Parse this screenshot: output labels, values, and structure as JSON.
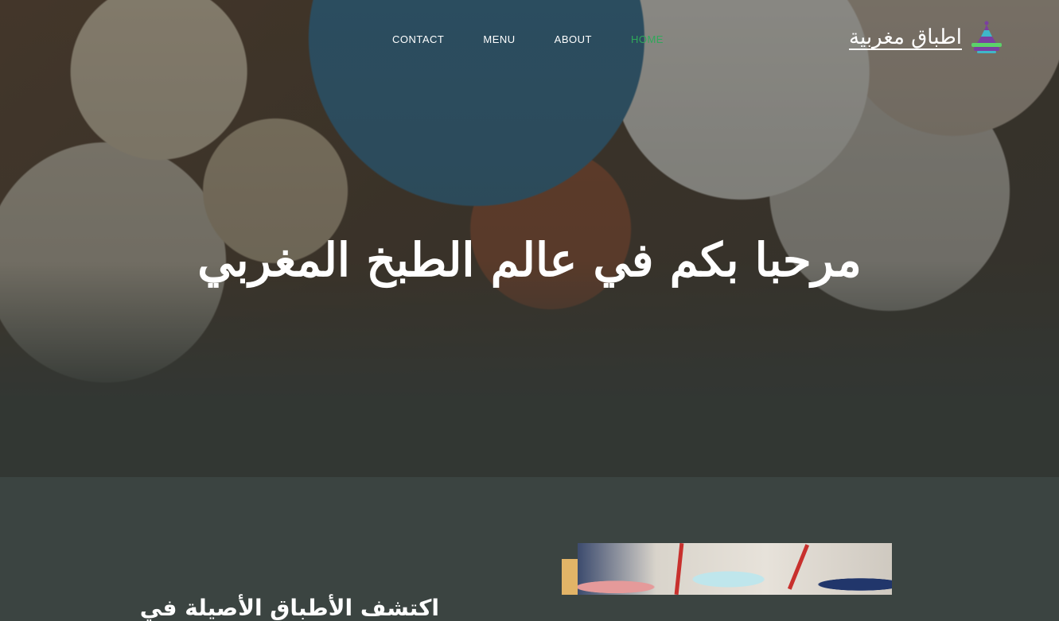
{
  "nav": {
    "items": [
      {
        "label": "CONTACT"
      },
      {
        "label": "MENU"
      },
      {
        "label": "ABOUT"
      },
      {
        "label": "HOME",
        "active": true
      }
    ],
    "active_color": "#2fa85a"
  },
  "logo": {
    "text": "اطباق مغربية",
    "icon": "tagine-icon"
  },
  "hero": {
    "title": "مرحبا بكم في عالم الطبخ المغربي",
    "image": "moroccan-dishes-table-photo"
  },
  "section": {
    "heading": "اكتشف الأطباق الأصيلة في",
    "image": "plates-and-utensils-photo",
    "accent_color": "#e2b467"
  },
  "colors": {
    "page_background": "#3b4441",
    "text": "#ffffff"
  }
}
